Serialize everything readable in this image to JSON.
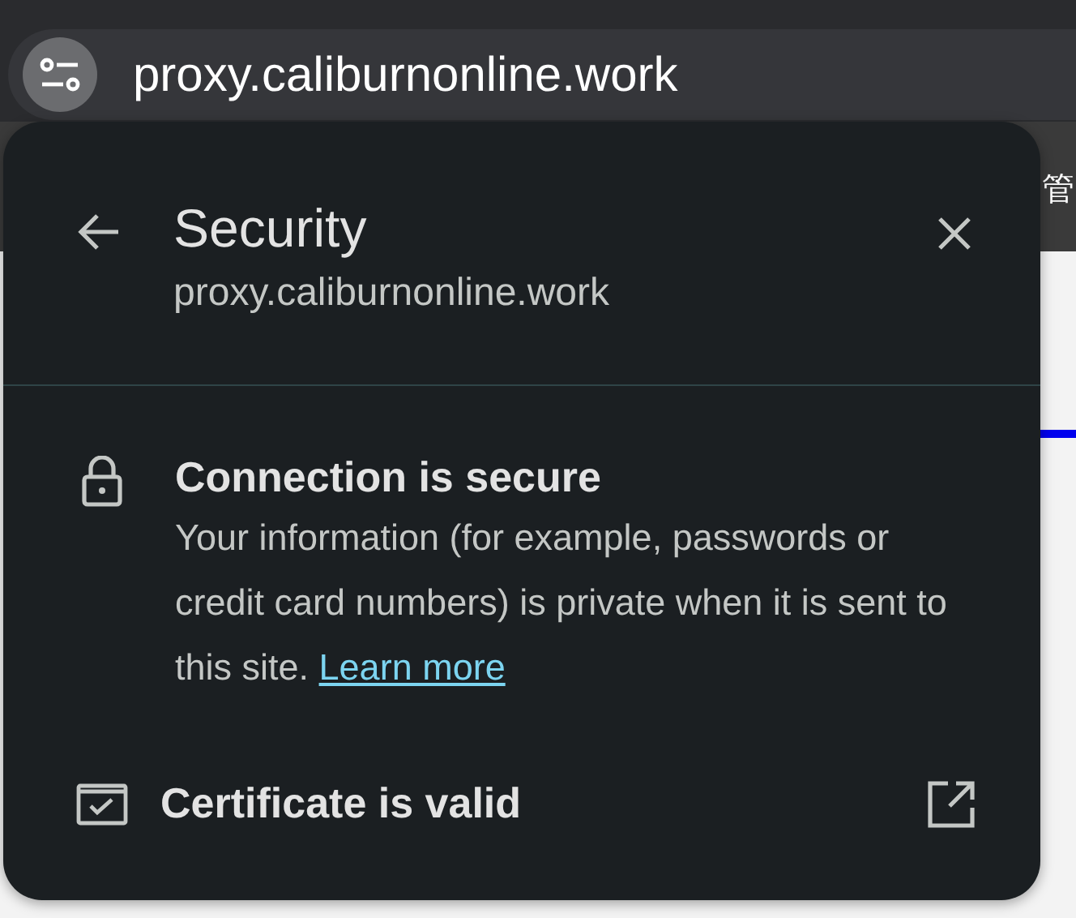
{
  "address_bar": {
    "url": "proxy.caliburnonline.work"
  },
  "background_page": {
    "toolbar_text": "管"
  },
  "security_panel": {
    "title": "Security",
    "subtitle": "proxy.caliburnonline.work",
    "connection": {
      "title": "Connection is secure",
      "text": "Your information (for example, passwords or credit card numbers) is private when it is sent to this site.",
      "link": "Learn more"
    },
    "certificate": {
      "label": "Certificate is valid"
    }
  }
}
